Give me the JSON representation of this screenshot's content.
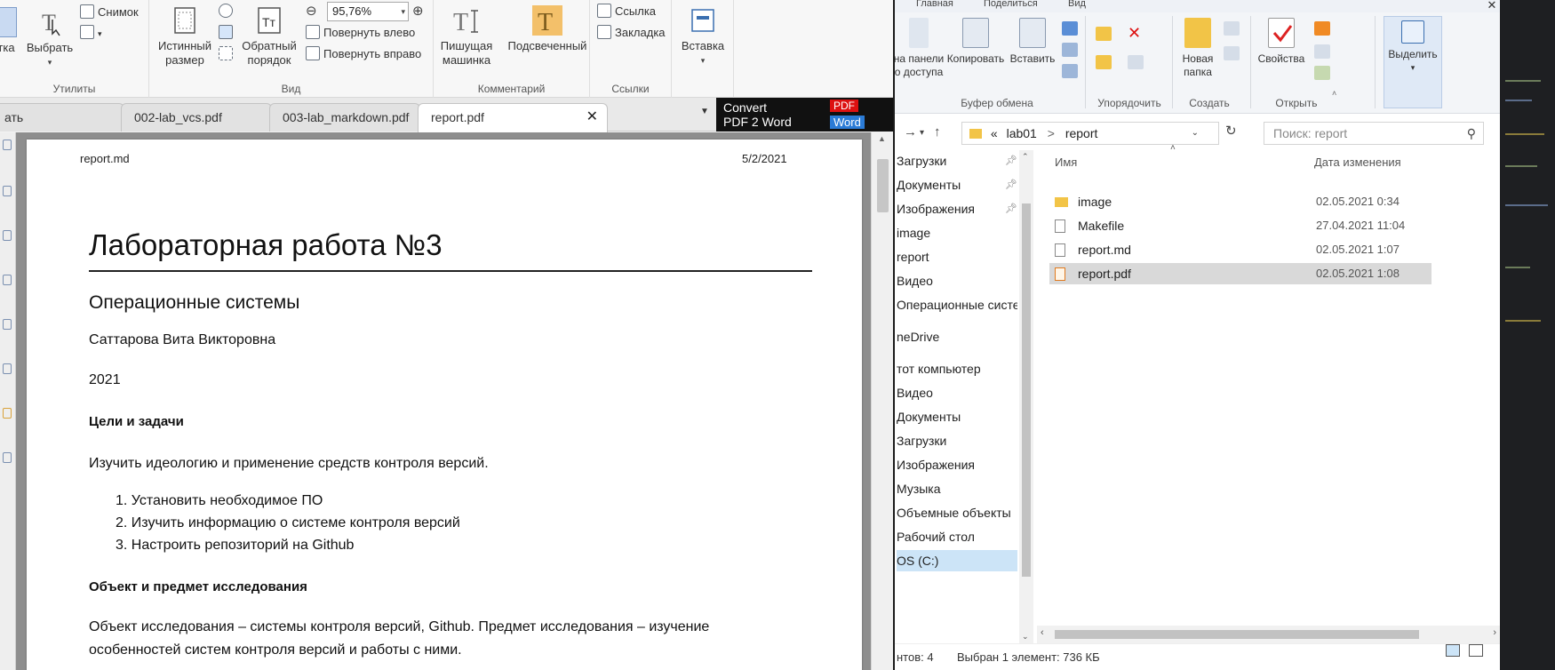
{
  "pdf_viewer": {
    "ribbon": {
      "partial_left_label": "тка",
      "select_label": "Выбрать",
      "snapshot_label": "Снимок",
      "utilities_group": "Утилиты",
      "actual_size_label": "Истинный размер",
      "reverse_order_label": "Обратный порядок",
      "zoom_value": "95,76%",
      "rotate_left_label": "Повернуть влево",
      "rotate_right_label": "Повернуть вправо",
      "view_group": "Вид",
      "typewriter_label": "Пишущая машинка",
      "highlighted_label": "Подсвеченный",
      "comments_group": "Комментарий",
      "link_label": "Ссылка",
      "bookmark_label": "Закладка",
      "links_group": "Ссылки",
      "insert_label": "Вставка"
    },
    "tabs": [
      {
        "label": "ать",
        "active": false
      },
      {
        "label": "002-lab_vcs.pdf",
        "active": false
      },
      {
        "label": "003-lab_markdown.pdf",
        "active": false
      },
      {
        "label": "report.pdf",
        "active": true
      }
    ],
    "convert_ad": {
      "line1": "Convert",
      "line2": "PDF 2 Word",
      "pdf_badge": "PDF",
      "word_badge": "Word"
    },
    "page": {
      "header_left": "report.md",
      "header_right": "5/2/2021",
      "title": "Лабораторная работа №3",
      "subtitle": "Операционные системы",
      "author": "Саттарова Вита Викторовна",
      "year": "2021",
      "goals_heading": "Цели и задачи",
      "goals_text": "Изучить идеологию и применение средств контроля версий.",
      "list_items": [
        "1. Установить необходимое ПО",
        "2. Изучить информацию о системе контроля версий",
        "3. Настроить репозиторий на Github"
      ],
      "object_heading": "Объект и предмет исследования",
      "object_text_1": "Объект исследования – системы контроля версий, Github. Предмет исследования – изучение",
      "object_text_2": "особенностей систем контроля версий и работы с ними."
    }
  },
  "explorer": {
    "tabs": {
      "home": "Главная",
      "share": "Поделиться",
      "view": "Вид"
    },
    "ribbon": {
      "pin_label_1": "на панели",
      "pin_label_2": "о доступа",
      "copy_label": "Копировать",
      "paste_label": "Вставить",
      "clipboard_group": "Буфер обмена",
      "organize_group": "Упорядочить",
      "new_folder_label": "Новая папка",
      "create_group": "Создать",
      "properties_label": "Свойства",
      "open_group": "Открыть",
      "select_label": "Выделить"
    },
    "address": {
      "path_prefix": "«",
      "path_part1": "lab01",
      "path_sep": ">",
      "path_part2": "report",
      "search_placeholder": "Поиск: report"
    },
    "nav_items": [
      {
        "label": "Загрузки",
        "pinned": true
      },
      {
        "label": "Документы",
        "pinned": true
      },
      {
        "label": "Изображения",
        "pinned": true
      },
      {
        "label": "image",
        "pinned": false
      },
      {
        "label": "report",
        "pinned": false
      },
      {
        "label": "Видео",
        "pinned": false
      },
      {
        "label": "Операционные систе",
        "pinned": false
      },
      {
        "label": "neDrive",
        "pinned": false
      },
      {
        "label": "тот компьютер",
        "pinned": false
      },
      {
        "label": "Видео",
        "pinned": false
      },
      {
        "label": "Документы",
        "pinned": false
      },
      {
        "label": "Загрузки",
        "pinned": false
      },
      {
        "label": "Изображения",
        "pinned": false
      },
      {
        "label": "Музыка",
        "pinned": false
      },
      {
        "label": "Объемные объекты",
        "pinned": false
      },
      {
        "label": "Рабочий стол",
        "pinned": false
      },
      {
        "label": "OS (C:)",
        "pinned": false
      }
    ],
    "columns": {
      "name": "Имя",
      "date": "Дата изменения"
    },
    "files": [
      {
        "name": "image",
        "date": "02.05.2021 0:34",
        "type": "folder",
        "selected": false
      },
      {
        "name": "Makefile",
        "date": "27.04.2021 11:04",
        "type": "file",
        "selected": false
      },
      {
        "name": "report.md",
        "date": "02.05.2021 1:07",
        "type": "file",
        "selected": false
      },
      {
        "name": "report.pdf",
        "date": "02.05.2021 1:08",
        "type": "pdf",
        "selected": true
      }
    ],
    "status": {
      "items_count": "нтов: 4",
      "selected_info": "Выбран 1 элемент: 736 КБ"
    }
  },
  "colors": {
    "selection_blue": "#cce4f7",
    "folder_yellow": "#f2c447",
    "ad_red": "#dd1111",
    "ad_blue": "#2b7bd6"
  }
}
